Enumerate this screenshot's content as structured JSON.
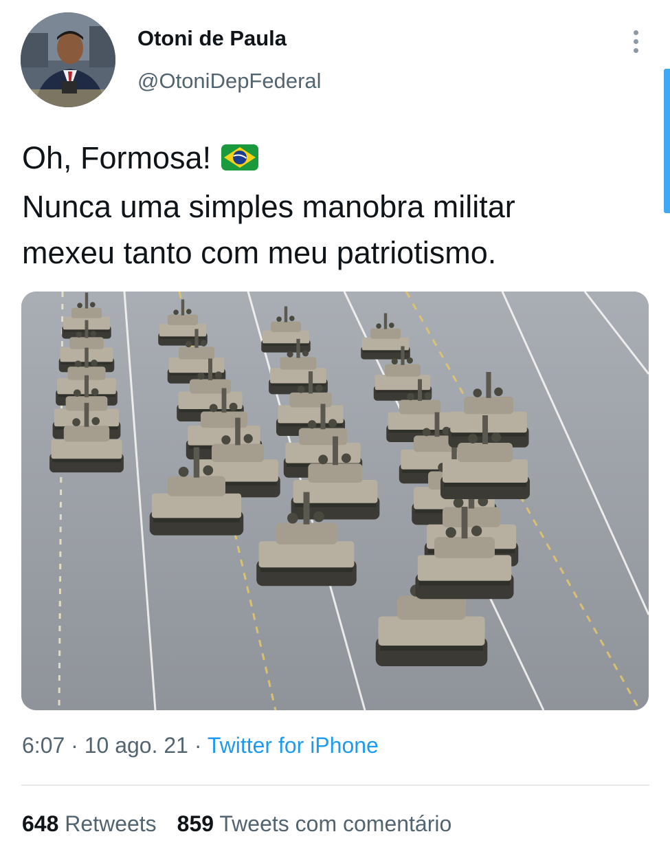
{
  "author": {
    "display_name": "Otoni de Paula",
    "handle": "@OtoniDepFederal",
    "avatar_icon": "profile-photo"
  },
  "tweet": {
    "lines": [
      "Oh, Formosa!",
      "Nunca uma simples manobra militar",
      "mexeu tanto com meu patriotismo."
    ],
    "emoji": "brazil-flag-icon",
    "media_description_icon": "photo-tanks-parade"
  },
  "meta": {
    "time": "6:07",
    "sep1": " · ",
    "date": "10 ago. 21",
    "sep2": " · ",
    "source": "Twitter for iPhone"
  },
  "stats": {
    "retweets_count": "648",
    "retweets_label": "Retweets",
    "quotes_count": "859",
    "quotes_label": "Tweets com comentário"
  },
  "colors": {
    "accent": "#1d9bf0",
    "secondary_text": "#536471",
    "primary_text": "#0f1419"
  }
}
